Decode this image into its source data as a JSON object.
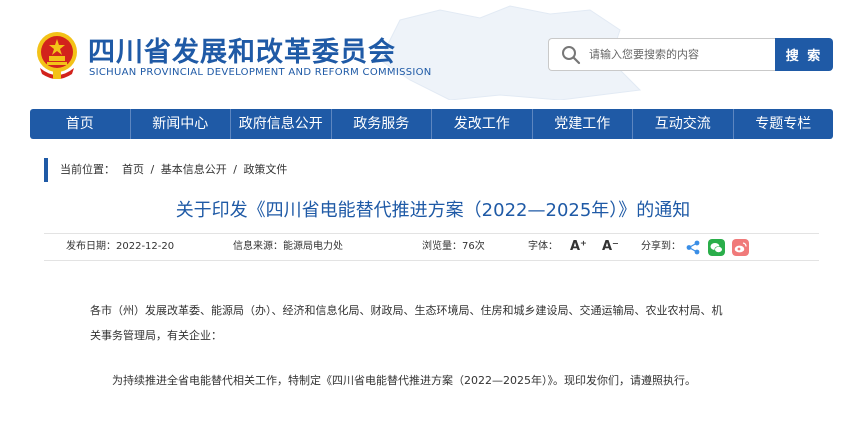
{
  "header": {
    "title": "四川省发展和改革委员会",
    "subtitle": "SICHUAN PROVINCIAL DEVELOPMENT AND REFORM COMMISSION"
  },
  "search": {
    "placeholder": "请输入您要搜索的内容",
    "button_label": "搜 索"
  },
  "nav": {
    "items": [
      "首页",
      "新闻中心",
      "政府信息公开",
      "政务服务",
      "发改工作",
      "党建工作",
      "互动交流",
      "专题专栏"
    ]
  },
  "breadcrumb": {
    "prefix": "当前位置：",
    "items": [
      "首页",
      "基本信息公开",
      "政策文件"
    ],
    "separator": "/"
  },
  "article": {
    "title": "关于印发《四川省电能替代推进方案（2022—2025年）》的通知",
    "meta": {
      "publish_date": "发布日期：2022-12-20",
      "source": "信息来源：能源局电力处",
      "views": "浏览量：76次",
      "font_label": "字体：",
      "font_increase": "A⁺",
      "font_decrease": "A⁻",
      "share_label": "分享到："
    },
    "paragraphs": [
      "各市（州）发展改革委、能源局（办）、经济和信息化局、财政局、生态环境局、住房和城乡建设局、交通运输局、农业农村局、机",
      "关事务管理局，有关企业：",
      "为持续推进全省电能替代相关工作，特制定《四川省电能替代推进方案（2022—2025年）》。现印发你们，请遵照执行。"
    ]
  },
  "icons": {
    "emblem": "national-emblem-icon",
    "search": "search-icon",
    "share": "share-icon",
    "wechat": "wechat-icon",
    "weibo": "weibo-icon"
  },
  "colors": {
    "brand_blue": "#1f5aa6",
    "emblem_red": "#d2231c",
    "emblem_gold": "#f3c218",
    "wechat_green": "#2aae4a",
    "weibo_pink": "#f07a7a",
    "share_blue": "#3a8ee6"
  }
}
